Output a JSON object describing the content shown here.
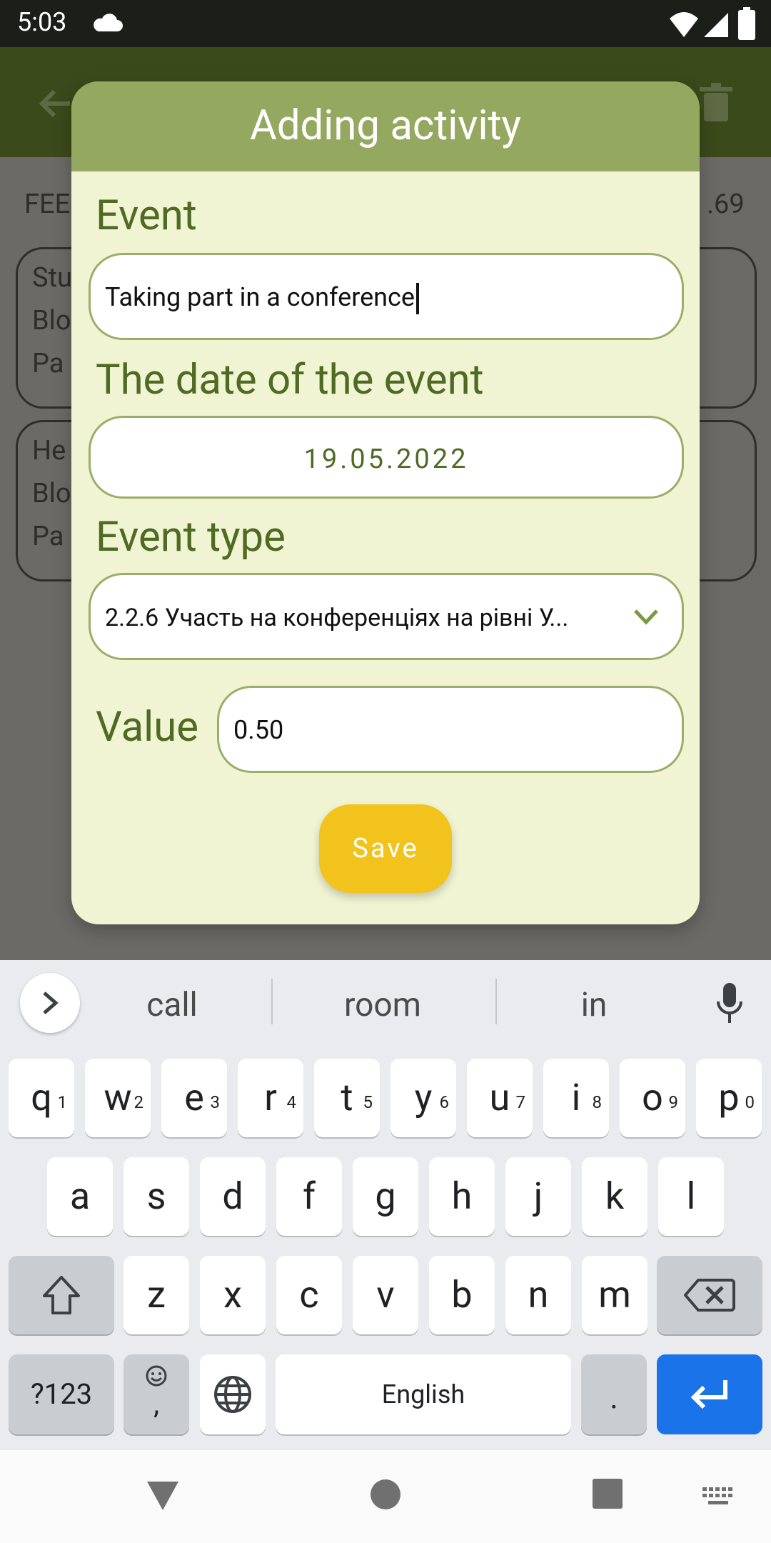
{
  "status": {
    "time": "5:03"
  },
  "background": {
    "date_prefix": "FEE",
    "score_suffix": ".69",
    "card1": [
      "Stu",
      "Blo",
      "Pa"
    ],
    "card2": [
      "He",
      "Blo",
      "Pa"
    ]
  },
  "dialog": {
    "title": "Adding activity",
    "event_label": "Event",
    "event_value": "Taking part in a conference",
    "date_label": "The date of the event",
    "date_value": "19.05.2022",
    "type_label": "Event type",
    "type_value": "2.2.6 Участь на конференціях на рівні У...",
    "value_label": "Value",
    "value_value": "0.50",
    "save_label": "Save"
  },
  "keyboard": {
    "suggestions": [
      "call",
      "room",
      "in"
    ],
    "row1": [
      "q",
      "w",
      "e",
      "r",
      "t",
      "y",
      "u",
      "i",
      "o",
      "p"
    ],
    "row1_nums": [
      "1",
      "2",
      "3",
      "4",
      "5",
      "6",
      "7",
      "8",
      "9",
      "0"
    ],
    "row2": [
      "a",
      "s",
      "d",
      "f",
      "g",
      "h",
      "j",
      "k",
      "l"
    ],
    "row3": [
      "z",
      "x",
      "c",
      "v",
      "b",
      "n",
      "m"
    ],
    "symbols_label": "?123",
    "space_label": "English",
    "period_label": ".",
    "emoji_comma": ","
  },
  "colors": {
    "accent_green": "#4e6a23",
    "header_green": "#94a860",
    "save_yellow": "#f2c31c",
    "enter_blue": "#1a73e8"
  },
  "icons": [
    "cloud-icon",
    "wifi-icon",
    "signal-icon",
    "battery-icon",
    "back-arrow-icon",
    "trash-icon",
    "chevron-down-icon",
    "chevron-right-icon",
    "mic-icon",
    "shift-icon",
    "backspace-icon",
    "emoji-icon",
    "globe-icon",
    "enter-icon",
    "nav-back-icon",
    "nav-home-icon",
    "nav-recents-icon",
    "keyboard-switch-icon"
  ]
}
